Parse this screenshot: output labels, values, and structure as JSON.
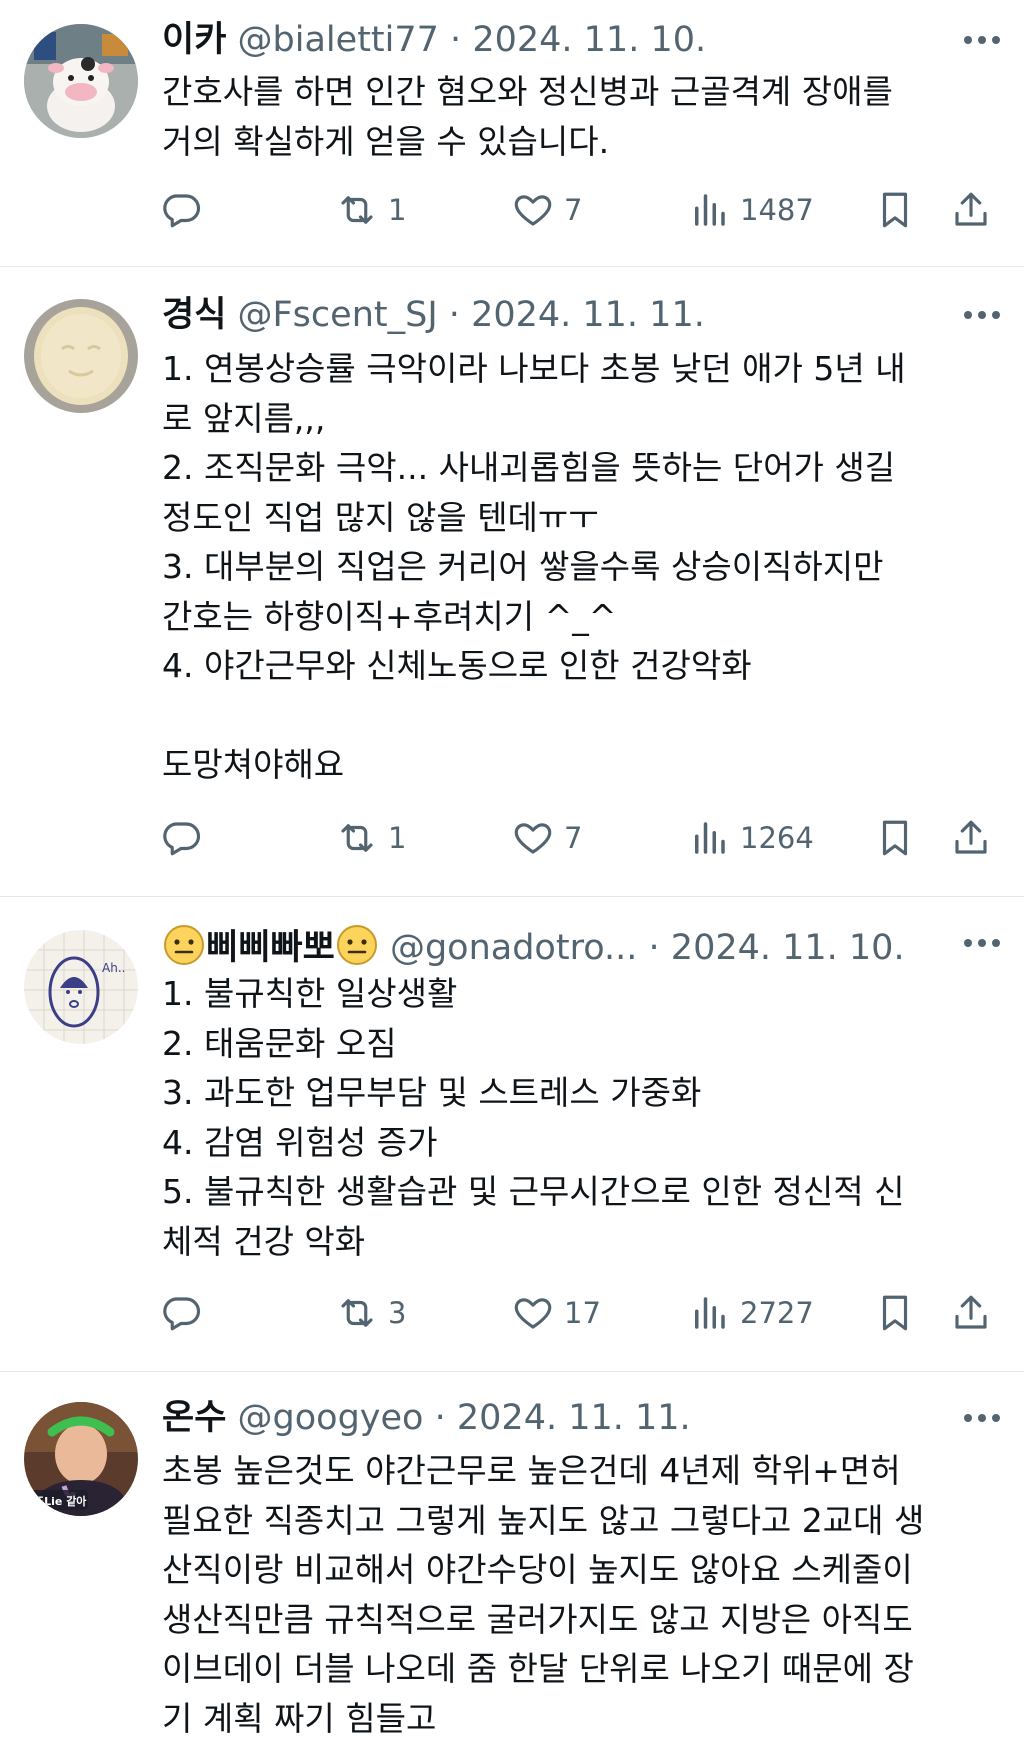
{
  "tweets": [
    {
      "name": "이카",
      "handle": "@bialetti77",
      "separator": "·",
      "date": "2024. 11. 10.",
      "text": "간호사를 하면 인간 혐오와 정신병과 근골격계 장애를\n거의 확실하게 얻을 수 있습니다.",
      "replies": "",
      "reposts": "1",
      "likes": "7",
      "views": "1487"
    },
    {
      "name": "경식",
      "handle": "@Fscent_SJ",
      "separator": "·",
      "date": "2024. 11. 11.",
      "text": "1. 연봉상승률 극악이라 나보다 초봉 낮던 애가 5년 내\n로 앞지름,,,\n2. 조직문화 극악... 사내괴롭힘을 뜻하는 단어가 생길\n정도인 직업 많지 않을 텐데ㅠㅜ\n3. 대부분의 직업은 커리어 쌓을수록 상승이직하지만\n간호는 하향이직+후려치기 ^_^\n4. 야간근무와 신체노동으로 인한 건강악화\n\n도망쳐야해요",
      "replies": "",
      "reposts": "1",
      "likes": "7",
      "views": "1264"
    },
    {
      "name": "삐삐빠뽀",
      "handle": "@gonadotro...",
      "separator": "·",
      "date": "2024. 11. 10.",
      "text": "1. 불규칙한 일상생활\n2. 태움문화 오짐\n3. 과도한 업무부담 및 스트레스 가중화\n4. 감염 위험성 증가\n5. 불규칙한 생활습관 및 근무시간으로 인한 정신적 신\n체적 건강 악화",
      "replies": "",
      "reposts": "3",
      "likes": "17",
      "views": "2727"
    },
    {
      "name": "온수",
      "handle": "@googyeo",
      "separator": "·",
      "date": "2024. 11. 11.",
      "text": "초봉 높은것도 야간근무로 높은건데 4년제 학위+면허\n필요한 직종치고 그렇게 높지도 않고 그렇다고 2교대 생\n산직이랑 비교해서 야간수당이 높지도 않아요 스케줄이\n생산직만큼 규칙적으로 굴러가지도 않고 지방은 아직도\n이브데이 더블 나오데 줌 한달 단위로 나오기 때문에 장\n기 계획 짜기 힘들고",
      "avatar_caption": "또Lie 같아"
    }
  ],
  "icons": {
    "reply": "reply-icon",
    "repost": "repost-icon",
    "like": "heart-icon",
    "views": "views-icon",
    "bookmark": "bookmark-icon",
    "share": "share-icon",
    "more": "more-icon"
  },
  "colors": {
    "text": "#0f1419",
    "secondary": "#536471",
    "divider": "#e6e6e6"
  }
}
